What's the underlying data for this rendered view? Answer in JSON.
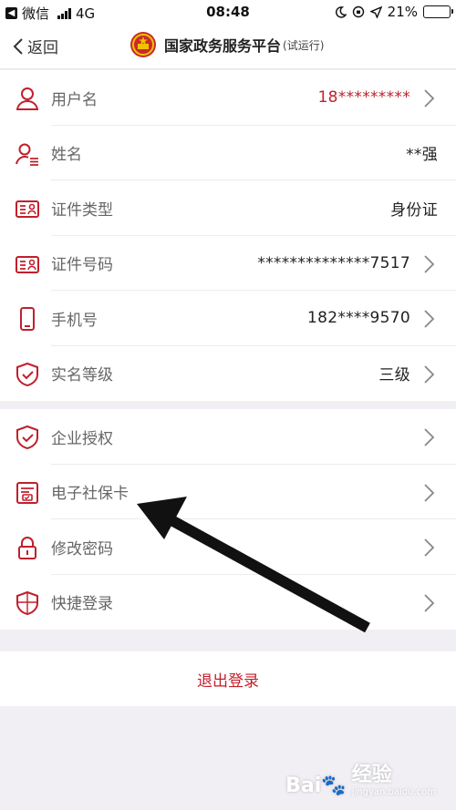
{
  "status_bar": {
    "app_back_label": "微信",
    "network": "4G",
    "time": "08:48",
    "battery_text": "21%",
    "battery_percent": 21
  },
  "nav": {
    "back_label": "返回",
    "title": "国家政务服务平台",
    "subtitle": "(试运行)"
  },
  "profile": [
    {
      "label": "用户名",
      "value": "18*********",
      "icon": "user-icon"
    },
    {
      "label": "姓名",
      "value": "**强",
      "icon": "name-card-icon"
    },
    {
      "label": "证件类型",
      "value": "身份证",
      "icon": "id-card-icon"
    },
    {
      "label": "证件号码",
      "value": "**************7517",
      "icon": "id-card-icon"
    },
    {
      "label": "手机号",
      "value": "182****9570",
      "icon": "phone-icon"
    },
    {
      "label": "实名等级",
      "value": "三级",
      "icon": "shield-check-icon"
    }
  ],
  "settings": [
    {
      "label": "企业授权",
      "icon": "shield-check-icon"
    },
    {
      "label": "电子社保卡",
      "icon": "social-security-card-icon"
    },
    {
      "label": "修改密码",
      "icon": "lock-icon"
    },
    {
      "label": "快捷登录",
      "icon": "shield-icon"
    }
  ],
  "logout_label": "退出登录",
  "colors": {
    "accent": "#c0202b",
    "background": "#f1eff4"
  },
  "watermark": {
    "brand": "Bai",
    "brand_cn": "经验",
    "url": "jingyan.baidu.com"
  }
}
